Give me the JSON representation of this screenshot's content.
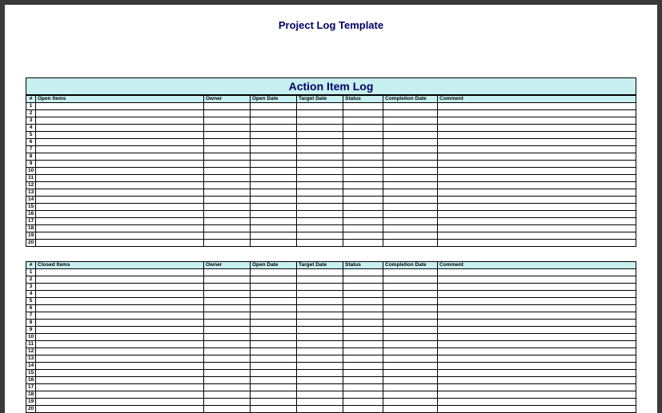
{
  "doc_title": "Project Log Template",
  "section_title": "Action Item Log",
  "tables": {
    "open": {
      "headers": [
        "#",
        "Open Items",
        "Owner",
        "Open Date",
        "Target Date",
        "Status",
        "Completion Date",
        "Comment"
      ],
      "rows": [
        {
          "num": "1"
        },
        {
          "num": "2"
        },
        {
          "num": "3"
        },
        {
          "num": "4"
        },
        {
          "num": "5"
        },
        {
          "num": "6"
        },
        {
          "num": "7"
        },
        {
          "num": "8"
        },
        {
          "num": "9"
        },
        {
          "num": "10"
        },
        {
          "num": "11"
        },
        {
          "num": "12"
        },
        {
          "num": "13"
        },
        {
          "num": "14"
        },
        {
          "num": "15"
        },
        {
          "num": "16"
        },
        {
          "num": "17"
        },
        {
          "num": "18"
        },
        {
          "num": "19"
        },
        {
          "num": "20"
        }
      ]
    },
    "closed": {
      "headers": [
        "#",
        "Closed Items",
        "Owner",
        "Open Date",
        "Target Date",
        "Status",
        "Completion Date",
        "Comment"
      ],
      "rows": [
        {
          "num": "1"
        },
        {
          "num": "2"
        },
        {
          "num": "3"
        },
        {
          "num": "4"
        },
        {
          "num": "5"
        },
        {
          "num": "6"
        },
        {
          "num": "7"
        },
        {
          "num": "8"
        },
        {
          "num": "9"
        },
        {
          "num": "10"
        },
        {
          "num": "11"
        },
        {
          "num": "12"
        },
        {
          "num": "13"
        },
        {
          "num": "14"
        },
        {
          "num": "15"
        },
        {
          "num": "16"
        },
        {
          "num": "17"
        },
        {
          "num": "18"
        },
        {
          "num": "19"
        },
        {
          "num": "20"
        }
      ]
    }
  }
}
